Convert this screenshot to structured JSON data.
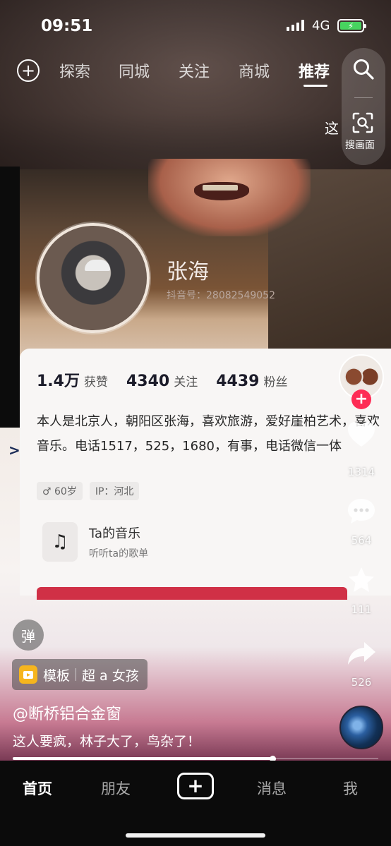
{
  "status": {
    "time": "09:51",
    "network": "4G",
    "battery_symbol": "⚡"
  },
  "topnav": {
    "tabs": [
      "探索",
      "同城",
      "关注",
      "商城",
      "推荐"
    ],
    "active": "推荐",
    "scan_label": "搜画面",
    "overlay_text": "这"
  },
  "video_profile": {
    "name": "张海",
    "douyin_id": "抖音号：28082549052",
    "stats": [
      {
        "num": "1.4万",
        "label": "获赞"
      },
      {
        "num": "4340",
        "label": "关注"
      },
      {
        "num": "4439",
        "label": "粉丝"
      }
    ],
    "bio": "本人是北京人，朝阳区张海，喜欢旅游，爱好崖柏艺术，喜欢音乐。电话1517，525，1680，有事，电话微信一体",
    "tags": [
      "♂ 60岁",
      "IP：河北"
    ],
    "music_title": "Ta的音乐",
    "music_sub": "听听ta的歌单"
  },
  "rail": {
    "likes": "1314",
    "comments": "564",
    "favorites": "111",
    "shares": "526"
  },
  "bottom_info": {
    "danmu": "弹",
    "template_label": "模板",
    "template_name": "超 a 女孩",
    "author": "@断桥铝合金窗",
    "caption": "这人要疯，林子大了，鸟杂了！",
    "progress": 0.71
  },
  "tabbar": {
    "tabs": [
      "首页",
      "朋友",
      "消息",
      "我"
    ],
    "active": "首页"
  }
}
